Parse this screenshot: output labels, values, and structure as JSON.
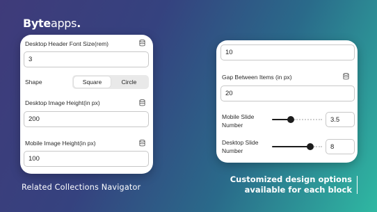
{
  "brand": {
    "bold": "Byte",
    "light": "apps",
    "dot": "."
  },
  "left_panel": {
    "header_font_size": {
      "label": "Desktop Header Font Size(rem)",
      "value": "3"
    },
    "shape": {
      "label": "Shape",
      "options": [
        "Square",
        "Circle"
      ],
      "selected": "Square"
    },
    "desktop_image_height": {
      "label": "Desktop Image Height(in px)",
      "value": "200"
    },
    "mobile_image_height": {
      "label": "Mobile Image Height(in px)",
      "value": "100"
    }
  },
  "right_panel": {
    "top_field": {
      "value": "10"
    },
    "gap_between_items": {
      "label": "Gap Between Items (in px)",
      "value": "20"
    },
    "mobile_slide_number": {
      "label_line1": "Mobile Slide",
      "label_line2": "Number",
      "value": "3.5",
      "slider_fraction": 0.35
    },
    "desktop_slide_number": {
      "label_line1": "Desktop Slide",
      "label_line2": "Number",
      "value": "8",
      "slider_fraction": 0.8
    }
  },
  "captions": {
    "left": "Related Collections Navigator",
    "right_line1": "Customized design options",
    "right_line2": "available for each block"
  },
  "icons": {
    "database": "database-icon"
  },
  "colors": {
    "accent_dark": "#1c1c1c",
    "bg_start": "#3f3b7a",
    "bg_end": "#2fb8a2"
  }
}
